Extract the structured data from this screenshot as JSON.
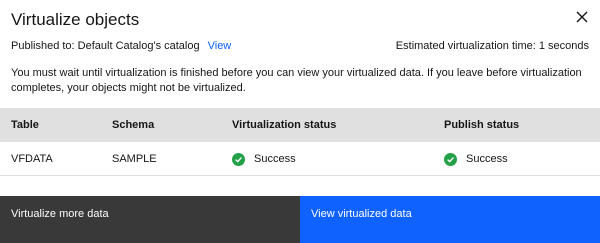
{
  "modal": {
    "title": "Virtualize objects",
    "close_icon": "close-icon",
    "published_label": "Published to: Default Catalog's catalog",
    "view_link": "View",
    "estimate": "Estimated virtualization time: 1 seconds",
    "notice": "You must wait until virtualization is finished before you can view your virtualized data. If you leave before virtualization completes, your objects might not be virtualized."
  },
  "table": {
    "headers": [
      "Table",
      "Schema",
      "Virtualization status",
      "Publish status"
    ],
    "rows": [
      {
        "table": "VFDATA",
        "schema": "SAMPLE",
        "virtualization_status": "Success",
        "publish_status": "Success"
      }
    ]
  },
  "footer": {
    "secondary_label": "Virtualize more data",
    "primary_label": "View virtualized data"
  },
  "colors": {
    "primary": "#0f62fe",
    "secondary": "#393939",
    "success": "#24a148",
    "table_header": "#e0e0e0"
  }
}
